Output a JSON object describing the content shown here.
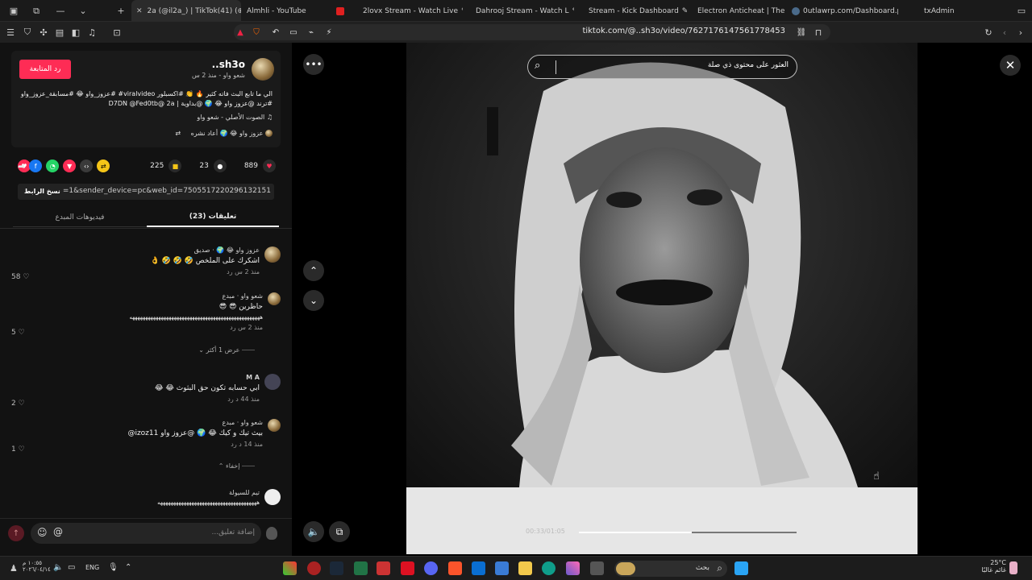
{
  "browser": {
    "tabs": [
      {
        "title": "2a (@il2a_) | TikTok(41) (⊕",
        "active": true
      },
      {
        "title": "Almhli - YouTube"
      },
      {
        "title": "2lovx Stream - Watch Live"
      },
      {
        "title": "Dahrooj Stream - Watch L"
      },
      {
        "title": "Stream - Kick Dashboard"
      },
      {
        "title": "Electron Anticheat | The #1 Fi"
      },
      {
        "title": "0utlawrp.com/Dashboard.php"
      },
      {
        "title": "txAdmin"
      }
    ],
    "new_tab": "+",
    "url": "tiktok.com/@..sh3o/video/7627176147561778453"
  },
  "post": {
    "username": "sh3o..",
    "subtitle": "شعو واو - منذ 2 س",
    "follow_label": "رد المتابعة",
    "caption_line1": "الي ما تابع البث فاته كثير 🔥 👏 #اكسبلور viralvideo# #عزوز_واو 😂 #مسابقة_عزوز_واو",
    "caption_line2": "#ترند @عزوز واو 😂 🌍 @بداوية | D7DN @Fed0tb@ 2a",
    "sound": "الصوت الأصلي - شعو واو",
    "repost": "عزوز واو 😂 🌍 أعاد نشره"
  },
  "actions": {
    "likes": "889",
    "comments": "23",
    "saves": "225"
  },
  "link": {
    "value": "pp=1&sender_device=pc&web_id=7505517220296132151...",
    "copy_label": "نسخ الرابط"
  },
  "tabs": {
    "comments": "تعليقات (23)",
    "creator_videos": "فيديوهات المبدع"
  },
  "comments": [
    {
      "name": "عزوز واو 😂 🌍 · صديق",
      "text": "اشكرك على الملخص 🤣 🤣 🤣 👌",
      "meta": "منذ 2 س   رد",
      "likes": "58"
    },
    {
      "name": "شعو واو · مبدع",
      "text": "حاظرين 😎 😎",
      "text2": "ههههههههههههههههههههههههههههههههههههههههههههههههههه",
      "meta": "منذ 2 س   رد",
      "likes": "5"
    },
    {
      "name": "M A",
      "text": "ابي حسابه تكون حق البثوث 😂 😂",
      "meta": "منذ 44 د   رد",
      "likes": "2"
    },
    {
      "name": "شعو واو · مبدع",
      "text": "بيث تيك و كيك 😂 🌍 @عزوز واو izoz11@",
      "meta": "منذ 14 د   رد",
      "likes": "1"
    },
    {
      "name": "تيم للسيولة",
      "text": "ههههههههههههههههههههههههههههههههههههههه",
      "meta": "",
      "likes": ""
    }
  ],
  "replies": {
    "show_more": "عرض 1 أكثر",
    "hide": "إخفاء"
  },
  "input": {
    "placeholder": "إضافة تعليق..."
  },
  "video": {
    "search_placeholder": "العثور على محتوى ذي صلة",
    "time": "00:33/01:05",
    "progress": 0.52
  },
  "taskbar": {
    "time": "١٠:٥٥ م",
    "date": "٢٠٢٦/٠٤/١٤",
    "lang": "ENG",
    "search": "بحث",
    "weather_temp": "25°C",
    "weather_text": "غائم غالبًا"
  },
  "colors": {
    "accent": "#fe2c55",
    "bg": "#121212"
  }
}
